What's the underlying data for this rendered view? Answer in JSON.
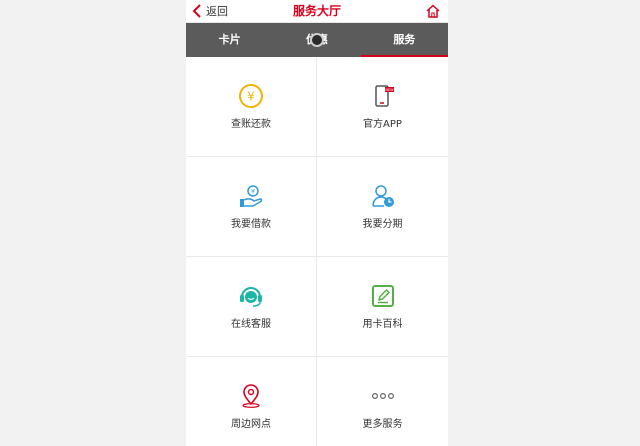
{
  "header": {
    "back_label": "返回",
    "title": "服务大厅",
    "home_icon": "home-icon"
  },
  "tabs": [
    {
      "label": "卡片",
      "active": false
    },
    {
      "label": "优惠",
      "active": false
    },
    {
      "label": "服务",
      "active": true
    }
  ],
  "services": [
    {
      "label": "查账还款",
      "icon": "yen-coin-icon"
    },
    {
      "label": "官方APP",
      "icon": "phone-new-icon"
    },
    {
      "label": "我要借款",
      "icon": "hand-coin-icon"
    },
    {
      "label": "我要分期",
      "icon": "user-installment-icon"
    },
    {
      "label": "在线客服",
      "icon": "headset-icon"
    },
    {
      "label": "用卡百科",
      "icon": "edit-icon"
    },
    {
      "label": "周边网点",
      "icon": "location-pin-icon"
    },
    {
      "label": "更多服务",
      "icon": "more-dots-icon"
    }
  ],
  "colors": {
    "brand_red": "#d6001c",
    "tab_bar": "#5b5b5b",
    "yellow": "#f0b400",
    "blue": "#2f9bd6",
    "teal": "#1bb6a6",
    "green": "#54b148"
  }
}
